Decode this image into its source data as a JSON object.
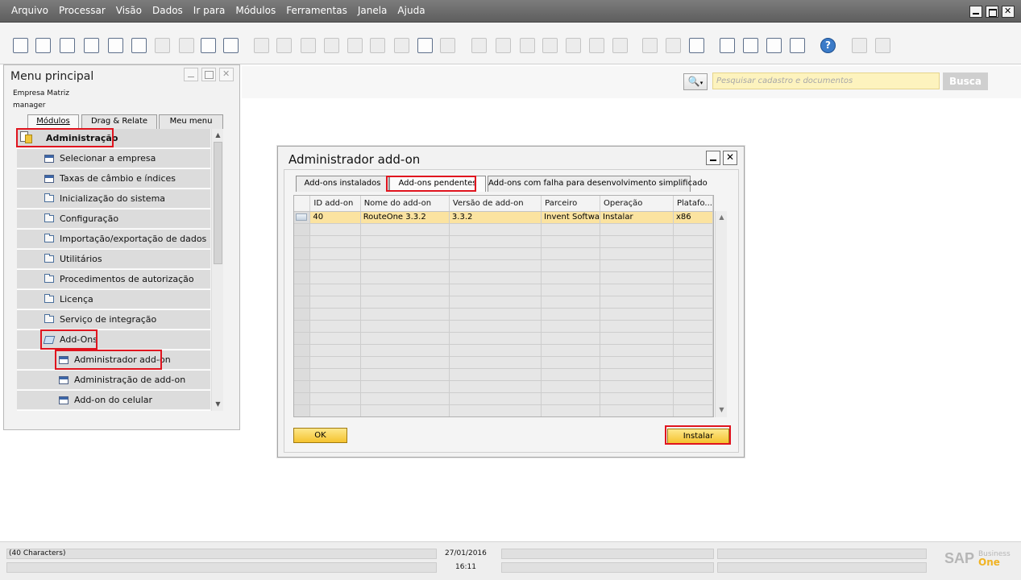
{
  "menubar": {
    "items": [
      "Arquivo",
      "Processar",
      "Visão",
      "Dados",
      "Ir para",
      "Módulos",
      "Ferramentas",
      "Janela",
      "Ajuda"
    ]
  },
  "toolbar": {
    "icons": [
      "preview-icon",
      "print-icon",
      "email-icon",
      "sms-icon",
      "fax-icon",
      "excel-export-icon",
      "word-export-icon",
      "pdf-export-icon",
      "launch-app-icon",
      "lock-screen-icon",
      "find-icon",
      "add-icon",
      "first-record-icon",
      "previous-record-icon",
      "next-record-icon",
      "last-record-icon",
      "refresh-icon",
      "filter-icon",
      "sort-icon",
      "base-document-icon",
      "target-document-icon",
      "journal-icon",
      "payment-icon",
      "gross-profit-icon",
      "volume-weight-icon",
      "tools-icon",
      "relationship-map-icon",
      "edit-form-icon",
      "settings-icon",
      "calendar-icon",
      "messages-icon",
      "alerts-icon",
      "relations-icon",
      "help-icon",
      "user-settings-icon",
      "form-settings-icon"
    ]
  },
  "search": {
    "placeholder": "Pesquisar cadastro e documentos",
    "button_label": "Busca"
  },
  "menu_panel": {
    "title": "Menu principal",
    "company": "Empresa Matriz",
    "user": "manager",
    "tabs": [
      "Módulos",
      "Drag & Relate",
      "Meu menu"
    ],
    "items": [
      {
        "label": "Administração",
        "level": 0,
        "type": "module",
        "highlighted": true
      },
      {
        "label": "Selecionar a empresa",
        "level": 1,
        "type": "form"
      },
      {
        "label": "Taxas de câmbio e índices",
        "level": 1,
        "type": "form"
      },
      {
        "label": "Inicialização do sistema",
        "level": 1,
        "type": "folder"
      },
      {
        "label": "Configuração",
        "level": 1,
        "type": "folder"
      },
      {
        "label": "Importação/exportação de dados",
        "level": 1,
        "type": "folder"
      },
      {
        "label": "Utilitários",
        "level": 1,
        "type": "folder"
      },
      {
        "label": "Procedimentos de autorização",
        "level": 1,
        "type": "folder"
      },
      {
        "label": "Licença",
        "level": 1,
        "type": "folder"
      },
      {
        "label": "Serviço de integração",
        "level": 1,
        "type": "folder"
      },
      {
        "label": "Add-Ons",
        "level": 1,
        "type": "folder-open",
        "highlighted": true
      },
      {
        "label": "Administrador add-on",
        "level": 2,
        "type": "form",
        "highlighted": true
      },
      {
        "label": "Administração de add-on",
        "level": 2,
        "type": "form"
      },
      {
        "label": "Add-on do celular",
        "level": 2,
        "type": "form"
      }
    ]
  },
  "dialog": {
    "title": "Administrador add-on",
    "tabs": [
      "Add-ons instalados",
      "Add-ons pendentes",
      "Add-ons com falha para desenvolvimento simplificado"
    ],
    "active_tab": "Add-ons pendentes",
    "columns": [
      "",
      "ID add-on",
      "Nome do add-on",
      "Versão de add-on",
      "Parceiro",
      "Operação",
      "Platafo..."
    ],
    "rows": [
      [
        "",
        "40",
        "RouteOne 3.3.2",
        "3.3.2",
        "Invent Softwa",
        "Instalar",
        "x86"
      ]
    ],
    "empty_rows": 16,
    "ok_label": "OK",
    "install_label": "Instalar"
  },
  "statusbar": {
    "message": "(40 Characters)",
    "date": "27/01/2016",
    "time": "16:11",
    "logo_sap": "SAP",
    "logo_business": "Business",
    "logo_one": "One"
  },
  "colors": {
    "highlight": "#e0141e",
    "selected_row": "#fbe3a0",
    "button_gold": "#f5c32f",
    "search_bg": "#fdf3be"
  }
}
